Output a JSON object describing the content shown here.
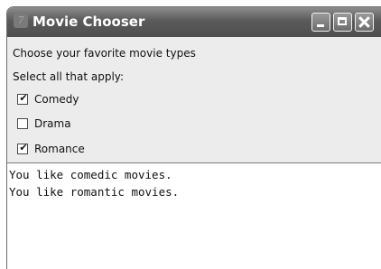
{
  "window": {
    "title": "Movie Chooser",
    "app_icon": "tk-feather-icon",
    "controls": [
      "minimize-icon",
      "maximize-icon",
      "close-icon"
    ]
  },
  "content": {
    "prompt": "Choose your favorite movie types",
    "instruction": "Select all that apply:",
    "checkboxes": [
      {
        "label": "Comedy",
        "checked": true
      },
      {
        "label": "Drama",
        "checked": false
      },
      {
        "label": "Romance",
        "checked": true
      }
    ],
    "output_lines": [
      "You like comedic movies.",
      "You like romantic movies."
    ]
  }
}
